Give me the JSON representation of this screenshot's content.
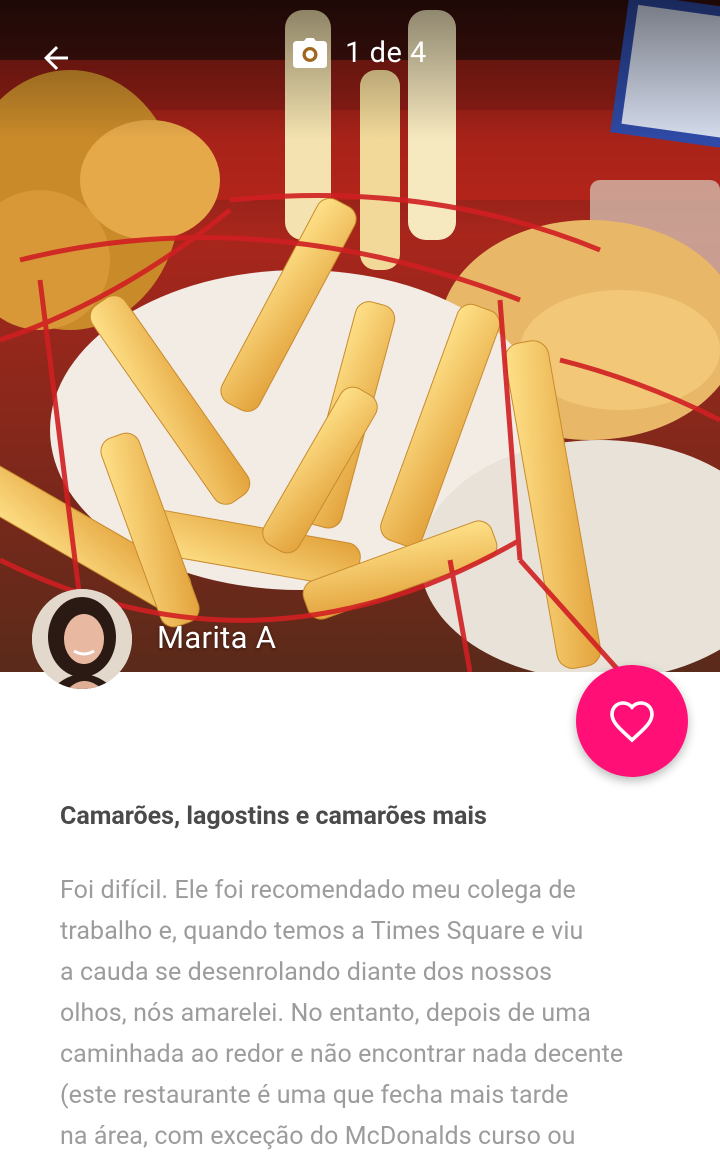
{
  "header": {
    "counter": "1 de 4",
    "icons": {
      "back": "arrow-left-icon",
      "camera": "camera-icon"
    }
  },
  "author": {
    "name": "Marita A"
  },
  "favorite": {
    "icon": "heart-outline-icon",
    "color": "#ff0f76"
  },
  "review": {
    "title": "Camarões, lagostins e camarões mais",
    "lines": [
      "Foi difícil. Ele foi recomendado meu colega de",
      "trabalho e, quando temos a Times Square e viu",
      "a cauda se desenrolando diante dos nossos",
      "olhos, nós amarelei. No entanto, depois de uma",
      "caminhada ao redor e não encontrar nada decente",
      "(este restaurante é uma que fecha mais tarde",
      "na área, com exceção do McDonalds curso ou"
    ]
  }
}
